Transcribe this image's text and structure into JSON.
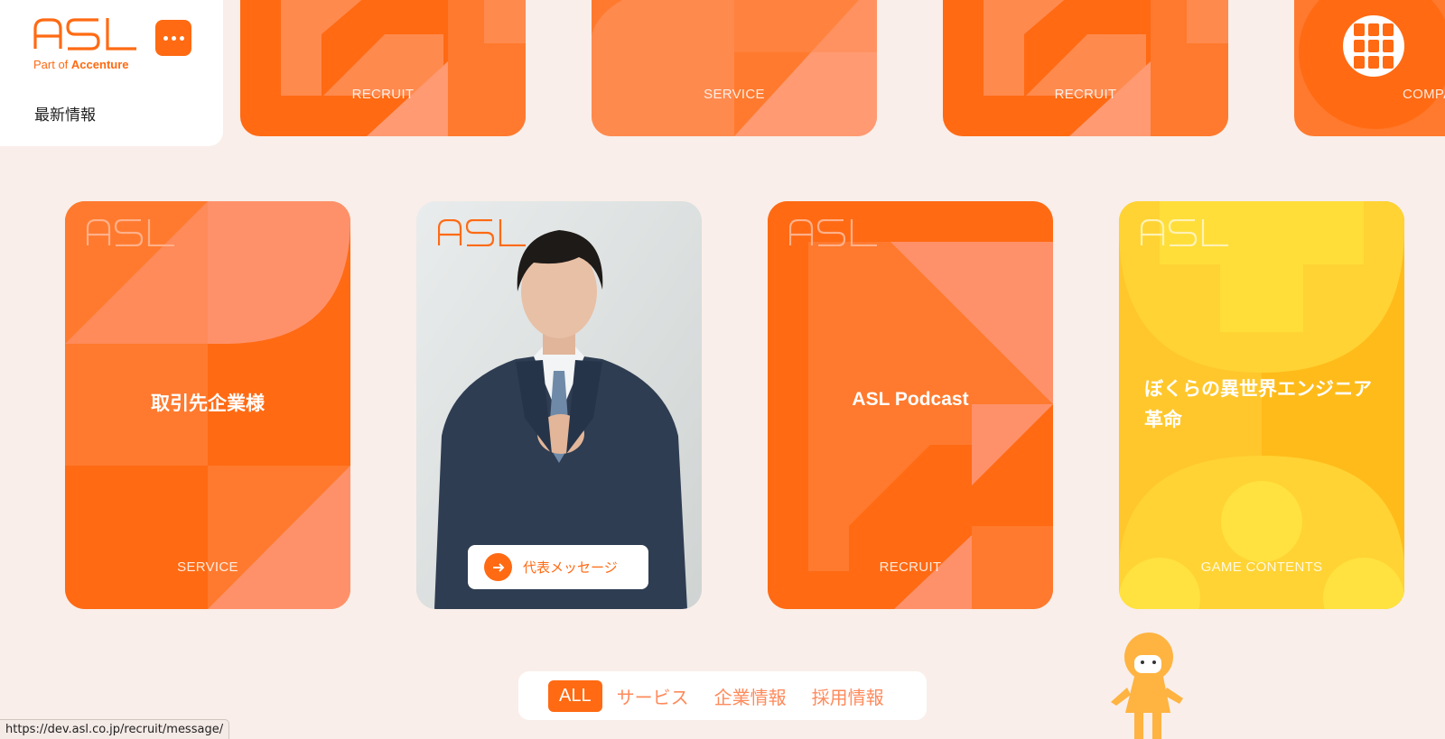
{
  "brand": {
    "logo_text": "ASL",
    "sub_prefix": "Part of ",
    "sub_name": "Accenture",
    "accent": "#ff6a13"
  },
  "nav": {
    "news_label": "最新情報",
    "menu_icon": "more-dots-icon",
    "grid_icon": "grid-menu-icon"
  },
  "top_row": [
    {
      "category": "RECRUIT"
    },
    {
      "category": "SERVICE"
    },
    {
      "category": "RECRUIT"
    },
    {
      "category": "COMPA"
    }
  ],
  "cards": [
    {
      "logo": "ASL",
      "title": "取引先企業様",
      "category": "SERVICE"
    },
    {
      "logo": "ASL",
      "button_label": "代表メッセージ"
    },
    {
      "logo": "ASL",
      "title": "ASL Podcast",
      "category": "RECRUIT"
    },
    {
      "logo": "ASL",
      "title": "ぼくらの異世界エンジニア革命",
      "category": "GAME CONTENTS"
    }
  ],
  "filters": [
    {
      "label": "ALL",
      "active": true
    },
    {
      "label": "サービス",
      "active": false
    },
    {
      "label": "企業情報",
      "active": false
    },
    {
      "label": "採用情報",
      "active": false
    }
  ],
  "status_url": "https://dev.asl.co.jp/recruit/message/"
}
